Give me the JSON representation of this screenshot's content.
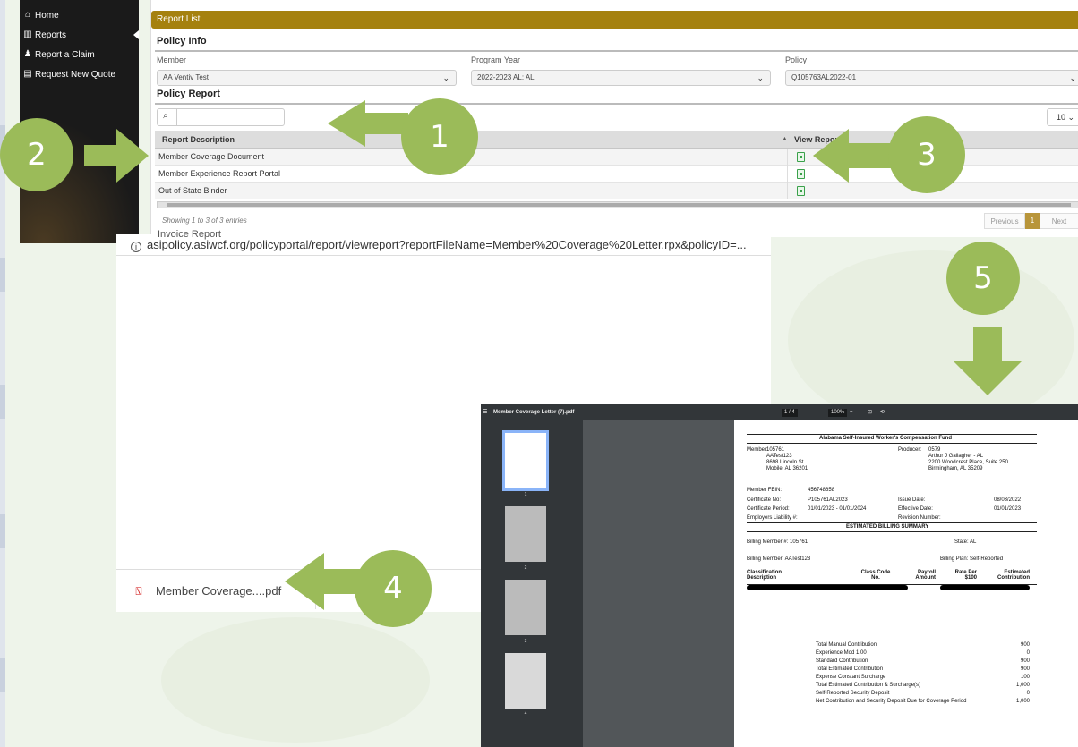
{
  "sidebar": {
    "items": [
      {
        "label": "Home",
        "icon": "home-icon"
      },
      {
        "label": "Reports",
        "icon": "chart-icon"
      },
      {
        "label": "Report a Claim",
        "icon": "user-icon"
      },
      {
        "label": "Request New Quote",
        "icon": "document-icon"
      }
    ]
  },
  "report_list": {
    "header": "Report List",
    "policy_info_title": "Policy Info",
    "member_label": "Member",
    "member_value": "AA Ventiv Test",
    "program_year_label": "Program Year",
    "program_year_value": "2022-2023 AL: AL",
    "policy_label": "Policy",
    "policy_value": "Q105763AL2022-01",
    "policy_report_title": "Policy Report",
    "page_length": "10",
    "columns": [
      "Report Description",
      "View Report"
    ],
    "rows": [
      "Member Coverage Document",
      "Member Experience Report Portal",
      "Out of State Binder"
    ],
    "showing": "Showing 1 to 3 of 3 entries",
    "pager": {
      "previous": "Previous",
      "current": "1",
      "next": "Next"
    }
  },
  "browser": {
    "tab_title": "Invoice Report",
    "url": "asipolicy.asiwcf.org/policyportal/report/viewreport?reportFileName=Member%20Coverage%20Letter.rpx&policyID=...",
    "download_name": "Member Coverage....pdf"
  },
  "pdf": {
    "file_name": "Member Coverage Letter (7).pdf",
    "page_indicator": "1 / 4",
    "zoom": "100%",
    "thumb_numbers": [
      "1",
      "2",
      "3",
      "4"
    ],
    "title": "Alabama Self-Insured Worker's Compensation Fund",
    "member_label": "Member:",
    "member_lines": [
      "105761",
      "AATest123",
      "8698 Lincoln St",
      "Mobile, AL 36201"
    ],
    "producer_label": "Producer:",
    "producer_lines": [
      "0579",
      "Arthur J Gallagher - AL",
      "2200 Woodcrest Place, Suite 250",
      "Birmingham, AL 35209"
    ],
    "fein_label": "Member FEIN:",
    "fein": "456748658",
    "cert_label": "Certificate No:",
    "cert": "P105761AL2023",
    "issue_label": "Issue Date:",
    "issue": "08/03/2022",
    "period_label": "Certificate Period:",
    "period": "01/01/2023 - 01/01/2024",
    "effective_label": "Effective Date:",
    "effective": "01/01/2023",
    "employers_label": "Employers Liability #:",
    "revision_label": "Revision Number:",
    "summary_title": "ESTIMATED BILLING SUMMARY",
    "billing_member_no": "Billing Member #:  105761",
    "state": "State:  AL",
    "billing_member": "Billing Member:  AATest123",
    "billing_plan": "Billing Plan:  Self-Reported",
    "table_headers": [
      "Classification Description",
      "Class Code No.",
      "Payroll Amount",
      "Rate Per $100",
      "Estimated Contribution"
    ],
    "totals": [
      {
        "label": "Total Manual Contribution",
        "value": "900"
      },
      {
        "label": "Experience Mod    1.00",
        "value": "0"
      },
      {
        "label": "Standard Contribution",
        "value": "900"
      },
      {
        "label": "Total Estimated Contribution",
        "value": "900"
      },
      {
        "label": "Expense Constant Surcharge",
        "value": "100"
      },
      {
        "label": "Total Estimated Contribution & Surcharge(s)",
        "value": "1,000"
      },
      {
        "label": "Self-Reported Security Deposit",
        "value": "0"
      },
      {
        "label": "Net Contribution and Security Deposit Due for Coverage Period",
        "value": "1,000"
      }
    ]
  },
  "callouts": [
    "1",
    "2",
    "3",
    "4",
    "5"
  ],
  "colors": {
    "accent_green": "#9bbb59",
    "header_gold": "#a5810f",
    "pdf_dark": "#323639"
  }
}
